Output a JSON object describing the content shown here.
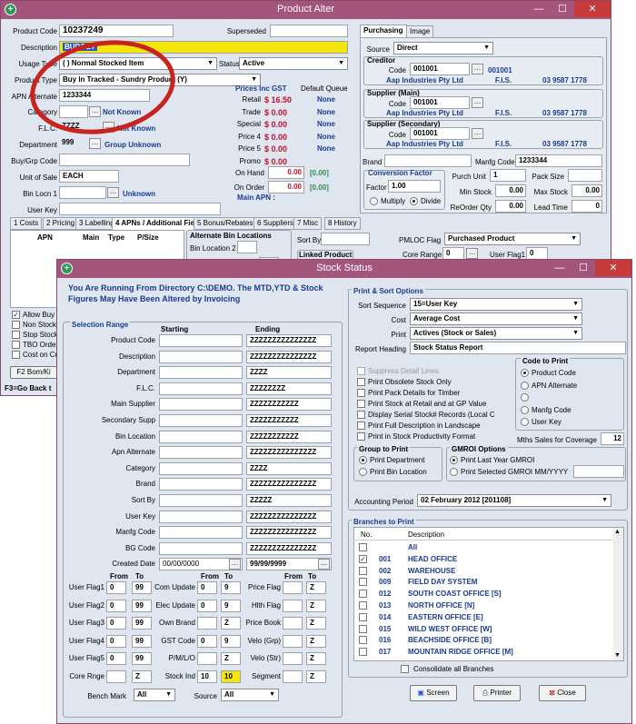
{
  "product_alter": {
    "title": "Product Alter",
    "win_btns": [
      "—",
      "☐",
      "✕"
    ],
    "product_code_label": "Product Code",
    "product_code": "10237249",
    "superseded_label": "Superseded",
    "superseded": "",
    "description_label": "Description",
    "description_value": "BUDGET",
    "usage_type_label": "Usage Type",
    "usage_type": "( ) Normal Stocked Item",
    "status_label": "Status",
    "status": "Active",
    "product_type_label": "Product Type",
    "product_type": "Buy In Tracked - Sundry Product (Y)",
    "apn_alternate_label": "APN Alternate",
    "apn_alternate": "1233344",
    "category_label": "Category",
    "category_value": "Not Known",
    "flc_label": "F.L.C.",
    "flc_code": "ZZZZ",
    "flc_value": "Not Known",
    "department_label": "Department",
    "department_code": "999",
    "department_value": "Group Unknown",
    "buy_grp_label": "Buy/Grp Code",
    "unit_of_sale_label": "Unit of Sale",
    "unit_of_sale": "EACH",
    "bin_locn_label": "Bin Locn 1",
    "bin_locn_value": "Unknown",
    "user_key_label": "User Key",
    "prices_header": "Prices Inc GST",
    "default_queue_header": "Default Queue",
    "prices": [
      {
        "label": "Retail",
        "value": "$ 16.50",
        "queue": "None"
      },
      {
        "label": "Trade",
        "value": "$ 0.00",
        "queue": "None"
      },
      {
        "label": "Special",
        "value": "$ 0.00",
        "queue": "None"
      },
      {
        "label": "Price 4",
        "value": "$ 0.00",
        "queue": "None"
      },
      {
        "label": "Price 5",
        "value": "$ 0.00",
        "queue": "None"
      },
      {
        "label": "Promo",
        "value": "$ 0.00",
        "queue": ""
      }
    ],
    "on_hand_label": "On Hand",
    "on_hand": "0.00",
    "on_hand_bracket": "[0.00]",
    "on_order_label": "On Order",
    "on_order": "0.00",
    "on_order_bracket": "[0.00]",
    "main_apn_label": "Main APN :",
    "right_tabs": [
      "Purchasing",
      "Image"
    ],
    "source_label": "Source",
    "source": "Direct",
    "creditor_header": "Creditor",
    "code_label": "Code",
    "creditor_code": "001001",
    "creditor_code2": "001001",
    "creditor_name": "Aap Industries Pty Ltd",
    "creditor_fis": "F.I.S.",
    "creditor_phone": "03 9587 1778",
    "supplier_main_header": "Supplier (Main)",
    "supplier_secondary_header": "Supplier (Secondary)",
    "brand_label": "Brand",
    "manfg_code_label": "Manfg Code",
    "manfg_code": "1233344",
    "conversion_header": "Conversion Factor",
    "factor_label": "Factor",
    "factor": "1.00",
    "multiply_label": "Multiply",
    "divide_label": "Divide",
    "purch_unit_label": "Purch Unit",
    "purch_unit": "1",
    "pack_size_label": "Pack Size",
    "min_stock_label": "Min Stock",
    "min_stock": "0.00",
    "max_stock_label": "Max Stock",
    "max_stock": "0.00",
    "reorder_qty_label": "ReOrder Qty",
    "reorder_qty": "0.00",
    "lead_time_label": "Lead Time",
    "lead_time": "0",
    "bottom_tabs": [
      "1 Costs",
      "2 Pricing",
      "3 Labelling",
      "4 APNs / Additional Fields",
      "5 Bonus/Rebates",
      "6 Suppliers",
      "7 Misc",
      "8 History"
    ],
    "apn_cols": [
      "APN",
      "Main",
      "Type",
      "P/Size"
    ],
    "alt_bin_header": "Alternate Bin Locations",
    "bin_location2_label": "Bin Location 2",
    "sort_by_label": "Sort By",
    "pmloc_flag_label": "PMLOC Flag",
    "pmloc_flag": "Purchased Product",
    "linked_product_header": "Linked Product",
    "core_range_label": "Core Range",
    "core_range": "0",
    "user_flag1_label": "User Flag1",
    "user_flag1": "0",
    "left_checks": [
      "Allow Buy Cr",
      "Non Stocked",
      "Stop Stock S",
      "TBO Order P",
      "Cost on Cus"
    ],
    "f2_button": "F2 Bom/Ki",
    "f3_text": "F3=Go Back t"
  },
  "stock_status": {
    "title": "Stock Status",
    "win_btns": [
      "—",
      "☐",
      "✕"
    ],
    "notice": "You Are Running From Directory C:\\DEMO. The MTD,YTD & Stock Figures May Have Been Altered by Invoicing",
    "selection_range_header": "Selection Range",
    "starting_header": "Starting",
    "ending_header": "Ending",
    "ranges": [
      {
        "label": "Product Code",
        "start": "",
        "end": "ZZZZZZZZZZZZZZZ"
      },
      {
        "label": "Description",
        "start": "",
        "end": "ZZZZZZZZZZZZZZZ"
      },
      {
        "label": "Department",
        "start": "",
        "end": "ZZZZ"
      },
      {
        "label": "F.L.C.",
        "start": "",
        "end": "ZZZZZZZZ"
      },
      {
        "label": "Main Supplier",
        "start": "",
        "end": "ZZZZZZZZZZZ"
      },
      {
        "label": "Secondary Supp",
        "start": "",
        "end": "ZZZZZZZZZZZ"
      },
      {
        "label": "Bin Location",
        "start": "",
        "end": "ZZZZZZZZZZZ"
      },
      {
        "label": "Apn Alternate",
        "start": "",
        "end": "ZZZZZZZZZZZZZZZ"
      },
      {
        "label": "Category",
        "start": "",
        "end": "ZZZZ"
      },
      {
        "label": "Brand",
        "start": "",
        "end": "ZZZZZZZZZZZZZZZ"
      },
      {
        "label": "Sort By",
        "start": "",
        "end": "ZZZZZ"
      },
      {
        "label": "User Key",
        "start": "",
        "end": "ZZZZZZZZZZZZZZZ"
      },
      {
        "label": "Manfg Code",
        "start": "",
        "end": "ZZZZZZZZZZZZZZZ"
      },
      {
        "label": "BG Code",
        "start": "",
        "end": "ZZZZZZZZZZZZZZZ"
      },
      {
        "label": "Created Date",
        "start": "00/00/0000",
        "end": "99/99/9999"
      }
    ],
    "from_label": "From",
    "to_label": "To",
    "flags_col1": [
      {
        "label": "User Flag1",
        "from": "0",
        "to": "99"
      },
      {
        "label": "User Flag2",
        "from": "0",
        "to": "99"
      },
      {
        "label": "User Flag3",
        "from": "0",
        "to": "99"
      },
      {
        "label": "User Flag4",
        "from": "0",
        "to": "99"
      },
      {
        "label": "User Flag5",
        "from": "0",
        "to": "99"
      },
      {
        "label": "Core Rnge",
        "from": "",
        "to": "Z"
      }
    ],
    "flags_col2": [
      {
        "label": "Com Update",
        "from": "0",
        "to": "9"
      },
      {
        "label": "Elec Update",
        "from": "0",
        "to": "9"
      },
      {
        "label": "Own Brand",
        "from": "",
        "to": "Z"
      },
      {
        "label": "GST Code",
        "from": "0",
        "to": "9"
      },
      {
        "label": "P/M/L/O",
        "from": "",
        "to": "Z"
      },
      {
        "label": "Stock Ind",
        "from": "10",
        "to": "10"
      }
    ],
    "flags_col3": [
      {
        "label": "Price Flag",
        "from": "",
        "to": "Z"
      },
      {
        "label": "Hlth Flag",
        "from": "",
        "to": "Z"
      },
      {
        "label": "Price Book",
        "from": "",
        "to": "Z"
      },
      {
        "label": "Velo (Grp)",
        "from": "",
        "to": "Z"
      },
      {
        "label": "Velo (Str)",
        "from": "",
        "to": "Z"
      },
      {
        "label": "Segment",
        "from": "",
        "to": "Z"
      }
    ],
    "bench_mark_label": "Bench Mark",
    "bench_mark": "All",
    "source_label": "Source",
    "source": "All",
    "print_sort_header": "Print & Sort Options",
    "sort_sequence_label": "Sort Sequence",
    "sort_sequence": "15=User Key",
    "cost_label": "Cost",
    "cost": "Average Cost",
    "print_label": "Print",
    "print": "Actives (Stock or Sales)",
    "report_heading_label": "Report Heading",
    "report_heading": "Stock Status Report",
    "checks": [
      "Suppress Detail Lines",
      "Print Obsolete Stock Only",
      "Print Pack Details for Timber",
      "Print Stock at Retail and at GP Value",
      "Display Serial Stock# Records (Local C",
      "Print Full Description in Landscape",
      "Print in Stock Productivity Format"
    ],
    "code_to_print_header": "Code to Print",
    "code_options": [
      "Product Code",
      "APN Alternate",
      "",
      "Manfg Code",
      "User Key"
    ],
    "mths_sales_label": "Mths Sales for Coverage",
    "mths_sales": "12",
    "group_to_print_header": "Group to Print",
    "group_options": [
      "Print Department",
      "Print Bin Location"
    ],
    "gmroi_header": "GMROI Options",
    "gmroi_options": [
      "Print Last Year GMROI",
      "Print Selected GMROI MM/YYYY"
    ],
    "accounting_period_label": "Accounting Period",
    "accounting_period": "02 February 2012 [201108]",
    "branches_header": "Branches to Print",
    "no_col": "No.",
    "desc_col": "Description",
    "branches": [
      {
        "no": "",
        "name": "All",
        "checked": false
      },
      {
        "no": "001",
        "name": "HEAD OFFICE",
        "checked": true
      },
      {
        "no": "002",
        "name": "WAREHOUSE",
        "checked": false
      },
      {
        "no": "009",
        "name": "FIELD DAY SYSTEM",
        "checked": false
      },
      {
        "no": "012",
        "name": "SOUTH COAST OFFICE [S]",
        "checked": false
      },
      {
        "no": "013",
        "name": "NORTH OFFICE [N]",
        "checked": false
      },
      {
        "no": "014",
        "name": "EASTERN OFFICE [E]",
        "checked": false
      },
      {
        "no": "015",
        "name": "WILD WEST OFFICE [W]",
        "checked": false
      },
      {
        "no": "016",
        "name": "BEACHSIDE OFFICE [B]",
        "checked": false
      },
      {
        "no": "017",
        "name": "MOUNTAIN RIDGE OFFICE [M]",
        "checked": false
      }
    ],
    "consolidate_label": "Consolidate all Branches",
    "screen_button": "Screen",
    "printer_button": "Printer",
    "close_button": "Close"
  },
  "colors": {
    "titlebar": "#a3557c",
    "body": "#dfe6ef",
    "accent": "#1a3b8f",
    "price_red": "#c0102a",
    "highlight": "#f4e60c",
    "annotation": "#c8231e"
  }
}
